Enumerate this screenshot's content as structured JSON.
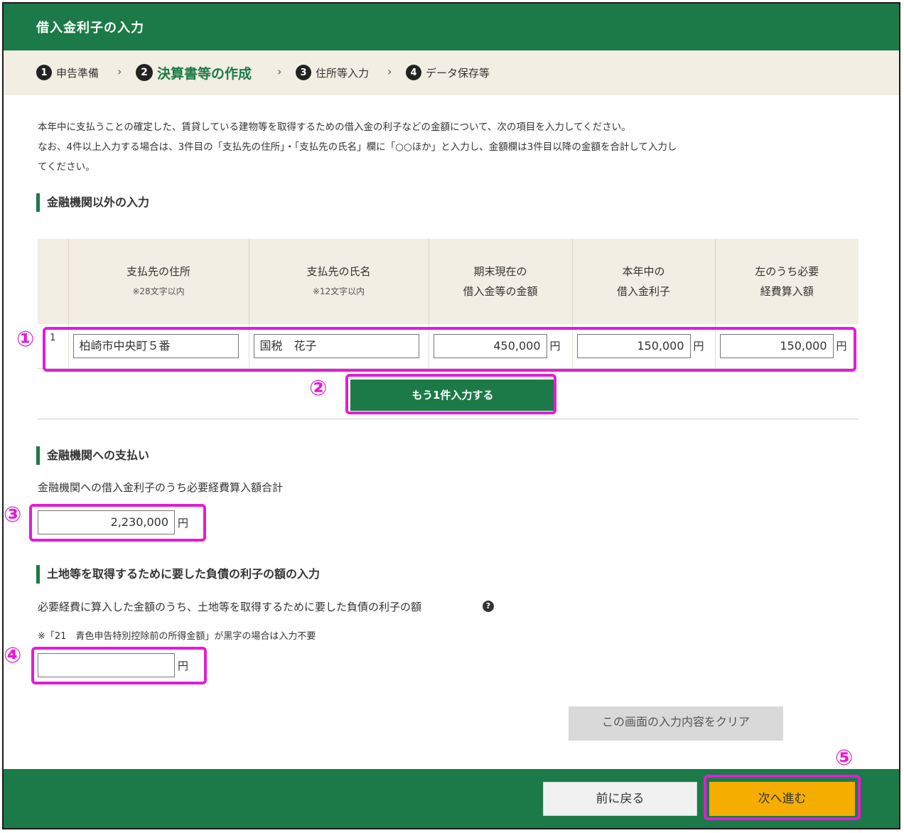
{
  "header": {
    "title": "借入金利子の入力"
  },
  "steps": [
    {
      "num": "1",
      "label": "申告準備",
      "active": false
    },
    {
      "num": "2",
      "label": "決算書等の作成",
      "active": true
    },
    {
      "num": "3",
      "label": "住所等入力",
      "active": false
    },
    {
      "num": "4",
      "label": "データ保存等",
      "active": false
    }
  ],
  "step_separator": "›",
  "intro": {
    "line1": "本年中に支払うことの確定した、賃貸している建物等を取得するための借入金の利子などの金額について、次の項目を入力してください。",
    "line2": "なお、4件以上入力する場合は、3件目の「支払先の住所」・「支払先の氏名」欄に「○○ほか」と入力し、金額欄は3件目以降の金額を合計して入力し",
    "line3": "てください。"
  },
  "non_financial": {
    "heading": "金融機関以外の入力",
    "columns": [
      {
        "title": "支払先の住所",
        "note": "※28文字以内"
      },
      {
        "title": "支払先の氏名",
        "note": "※12文字以内"
      },
      {
        "title": "期末現在の",
        "title2": "借入金等の金額"
      },
      {
        "title": "本年中の",
        "title2": "借入金利子"
      },
      {
        "title": "左のうち必要",
        "title2": "経費算入額"
      }
    ],
    "rows": [
      {
        "no": "1",
        "address": "柏崎市中央町５番",
        "name": "国税　花子",
        "balance": "450,000",
        "interest": "150,000",
        "expense": "150,000"
      }
    ],
    "unit": "円",
    "add_button": "もう1件入力する"
  },
  "financial": {
    "heading": "金融機関への支払い",
    "label": "金融機関への借入金利子のうち必要経費算入額合計",
    "value": "2,230,000",
    "unit": "円"
  },
  "land": {
    "heading": "土地等を取得するために要した負債の利子の額の入力",
    "label": "必要経費に算入した金額のうち、土地等を取得するために要した負債の利子の額",
    "help": "?",
    "note": "※「21　青色申告特別控除前の所得金額」が黒字の場合は入力不要",
    "value": "",
    "unit": "円"
  },
  "buttons": {
    "clear": "この画面の入力内容をクリア",
    "back": "前に戻る",
    "next": "次へ進む"
  },
  "callouts": [
    "①",
    "②",
    "③",
    "④",
    "⑤"
  ],
  "colors": {
    "brand_green": "#1b7a47",
    "step_bg": "#f2eee3",
    "next_orange": "#f5ad00",
    "highlight_magenta": "#e31bd6"
  }
}
